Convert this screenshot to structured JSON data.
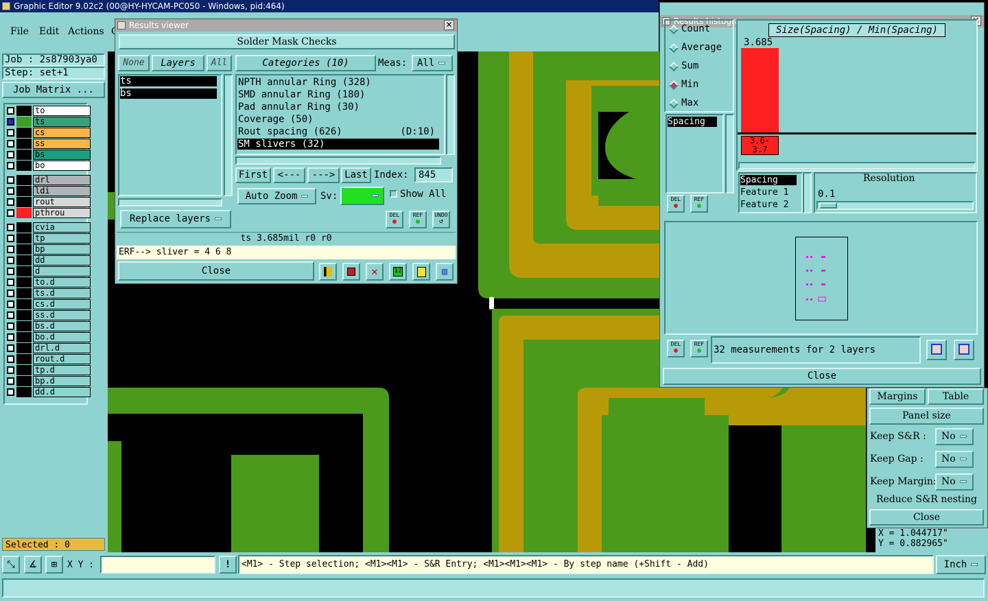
{
  "main_window": {
    "title": "Graphic Editor 9.02c2 (00@HY-HYCAM-PC050 - Windows, pid:464)"
  },
  "menu": [
    "File",
    "Edit",
    "Actions",
    "O"
  ],
  "job": {
    "job_label": "Job : 2s87903ya0",
    "step_label": "Step: set+1",
    "job_matrix": "Job Matrix ..."
  },
  "layers": {
    "group1": [
      {
        "name": "to",
        "color": "#ffffff",
        "sw": "#000000"
      },
      {
        "name": "ts",
        "color": "#3aa07a",
        "sw": "#3aa02a"
      },
      {
        "name": "cs",
        "color": "#f7b54a",
        "sw": "#000000"
      },
      {
        "name": "ss",
        "color": "#f7b54a",
        "sw": "#000000"
      },
      {
        "name": "bs",
        "color": "#1aa080",
        "sw": "#000000"
      },
      {
        "name": "bo",
        "color": "#ffffff",
        "sw": "#000000"
      }
    ],
    "group2": [
      {
        "name": "drl",
        "color": "#b0b4b8",
        "sw": "#000000"
      },
      {
        "name": "ldi",
        "color": "#b0b4b8",
        "sw": "#000000"
      },
      {
        "name": "rout",
        "color": "#d8d8d8",
        "sw": "#000000"
      },
      {
        "name": "pthrou",
        "color": "#d8d8d8",
        "sw": "#ff2020"
      }
    ],
    "group3": [
      "cvia",
      "tp",
      "bp",
      "dd",
      "d",
      "to.d",
      "ts.d",
      "cs.d",
      "ss.d",
      "bs.d",
      "bo.d",
      "drl.d",
      "rout.d",
      "tp.d",
      "bp.d",
      "dd.d"
    ]
  },
  "selected": "Selected : 0",
  "results_viewer": {
    "title": "Results viewer",
    "header": "Solder Mask Checks",
    "none": "None",
    "layers": "Layers",
    "all": "All",
    "layer_list": [
      "ts",
      "bs"
    ],
    "categories": "Categories (10)",
    "meas_label": "Meas:",
    "meas_value": "All",
    "items": [
      {
        "text": "NPTH annular Ring (328)",
        "extra": ""
      },
      {
        "text": "SMD annular Ring (180)",
        "extra": ""
      },
      {
        "text": "Pad annular Ring (30)",
        "extra": ""
      },
      {
        "text": "Coverage (50)",
        "extra": ""
      },
      {
        "text": "Rout spacing (626)",
        "extra": "(D:10)"
      },
      {
        "text": "SM slivers (32)",
        "extra": ""
      }
    ],
    "first": "First",
    "prev": "<---",
    "next": "--->",
    "last": "Last",
    "index_label": "Index:",
    "index_value": "845",
    "auto_zoom": "Auto Zoom",
    "sv": "Sv:",
    "show_all": "Show All",
    "replace_layers": "Replace layers",
    "del": "DEL",
    "ref": "REF",
    "undo": "UNDO",
    "status": "ts 3.685mil  r0  r0",
    "erf": "ERF--> sliver = 4 6 8",
    "close": "Close"
  },
  "histogram": {
    "title": "Results histogram",
    "modes": [
      "Count",
      "Average",
      "Sum",
      "Min",
      "Max"
    ],
    "selected_mode": "Min",
    "chart_title": "Size(Spacing) / Min(Spacing)",
    "bar_value": "3.685",
    "bar_label": "3.6-\n3.7",
    "list": [
      "Spacing"
    ],
    "sel_list": [
      "Spacing",
      "Feature 1",
      "Feature 2"
    ],
    "resolution_label": "Resolution",
    "resolution_value": "0.1",
    "measurements": "32 measurements for 2 layers",
    "del": "DEL",
    "ref": "REF",
    "close": "Close"
  },
  "panel": {
    "margins": "Margins",
    "table": "Table",
    "panel_size": "Panel size",
    "keep_sr": "Keep S&R :",
    "keep_gap": "Keep Gap :",
    "keep_margin": "Keep Margin:",
    "no": "No",
    "reduce": "Reduce S&R nesting",
    "close": "Close"
  },
  "coords": {
    "x": "X = 1.044717\"",
    "y": "Y = 0.882965\""
  },
  "bottom": {
    "xy": "X Y :",
    "hint": "<M1> - Step selection; <M1><M1> - S&R Entry; <M1><M1><M1> - By step name (+Shift - Add)",
    "unit": "Inch"
  },
  "colors": {
    "teal": "#8fd3d0",
    "pcb_green": "#4c9a1c",
    "pcb_gold": "#b89a08",
    "bar": "#ff2020"
  }
}
